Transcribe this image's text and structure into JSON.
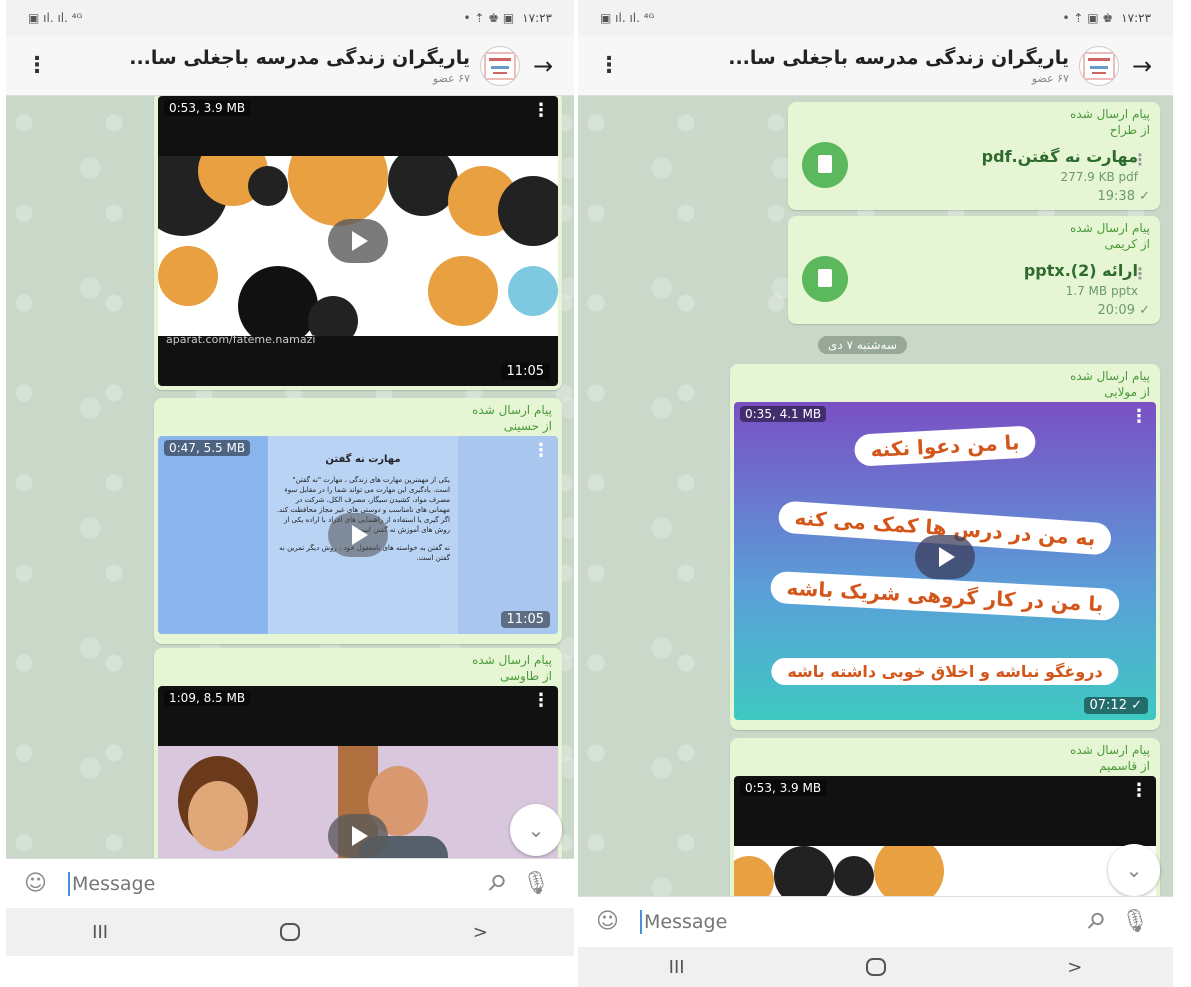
{
  "colors": {
    "chat_bg": "#c9d8c8",
    "bubble": "#e6f6d4",
    "accent_green": "#5cb85c"
  },
  "left": {
    "statusbar": {
      "left_icons": "▣ ıl. ıl. ⁴ᴳ",
      "right_icons": "• ⇡ ♚ ▣",
      "time": "۱۷:۲۳"
    },
    "header": {
      "title": "یاریگران زندگی مدرسه باجغلی سا...",
      "members": "۶۷ عضو"
    },
    "messages": [
      {
        "video_info": "0:53, 3.9 MB",
        "watermark": "aparat.com/fateme.namazi",
        "time": "11:05"
      },
      {
        "forward_label": "پیام ارسال شده",
        "forward_from": "از حسینی",
        "video_info": "0:47, 5.5 MB",
        "time": "11:05",
        "doc_title": "مهارت نه گفتن",
        "doc_body": "یکی از مهمترین مهارت های زندگی ، مهارت \"نه گفتن\" است. یادگیری این مهارت می تواند شما را در مقابل سوء مصرف مواد، کشیدن سیگار، مصرف الکل، شرکت در مهمانی های نامناسب و دوستی های غیر مجاز محافظت کند. اگر گیری یا استفاده از راهنمایی های افراد با اراده یکی از روش های آموزش نه گفتن است.",
        "doc_foot": "نه گفتن به خواسته های نامعقول خود ، روش دیگر تمرین نه گفتن است."
      },
      {
        "forward_label": "پیام ارسال شده",
        "forward_from": "از طاوسی",
        "video_info": "1:09, 8.5 MB"
      }
    ],
    "composer": {
      "placeholder": "Message"
    },
    "nav": {
      "recents": "III",
      "back": ">"
    }
  },
  "right": {
    "statusbar": {
      "left_icons": "▣ ıl. ıl. ⁴ᴳ",
      "right_icons": "• ⇡ ▣ ♚",
      "time": "۱۷:۲۳"
    },
    "header": {
      "title": "یاریگران زندگی مدرسه باجغلی سا...",
      "members": "۶۷ عضو"
    },
    "messages": [
      {
        "forward_label": "پیام ارسال شده",
        "forward_from": "از طراح",
        "file_name": "مهارت نه گفتن.pdf",
        "file_meta": "277.9 KB pdf",
        "time": "19:38"
      },
      {
        "forward_label": "پیام ارسال شده",
        "forward_from": "از کریمی",
        "file_name": "ارائه (2).pptx",
        "file_meta": "1.7 MB pptx",
        "time": "20:09"
      },
      {
        "forward_label": "پیام ارسال شده",
        "forward_from": "از مولایی",
        "video_info": "0:35, 4.1 MB",
        "time": "07:12",
        "lines": [
          "با من دعوا نکنه",
          "به من در درس ها کمک می کنه",
          "با من در کار گروهی شریک باشه",
          "دروغگو نباشه و اخلاق خوبی داشته باشه"
        ]
      },
      {
        "forward_label": "پیام ارسال شده",
        "forward_from": "از قاسمیم",
        "video_info": "0:53, 3.9 MB"
      }
    ],
    "date_separator": "سه‌شنبه ۷ دی",
    "composer": {
      "placeholder": "Message"
    },
    "nav": {
      "recents": "III",
      "back": ">"
    }
  }
}
